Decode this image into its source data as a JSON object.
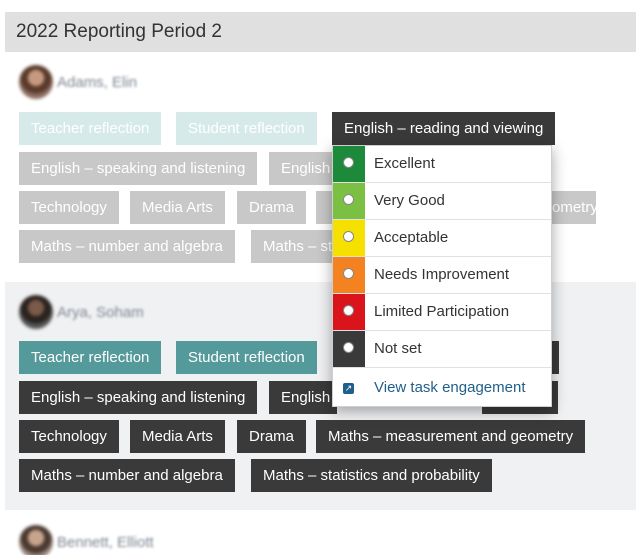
{
  "header": {
    "title": "2022 Reporting Period 2"
  },
  "students": [
    {
      "name": "Adams, Elin"
    },
    {
      "name": "Arya, Soham"
    },
    {
      "name": "Bennett, Elliott"
    }
  ],
  "tags": {
    "teacher_reflection": "Teacher reflection",
    "student_reflection": "Student reflection",
    "english_reading": "English – reading and viewing",
    "english_speaking": "English – speaking and listening",
    "english_partial": "English",
    "technology": "Technology",
    "media_arts": "Media Arts",
    "drama": "Drama",
    "maths_measurement": "Maths – measurement and geometry",
    "maths_measurement_tail": "ometry",
    "maths_number": "Maths – number and algebra",
    "maths_stats": "Maths – statistics and probability",
    "maths_stats_partial": "Maths – st"
  },
  "dropdown": {
    "options": [
      {
        "label": "Excellent",
        "color": "#1c8a3a"
      },
      {
        "label": "Very Good",
        "color": "#7bc043"
      },
      {
        "label": "Acceptable",
        "color": "#f5e000"
      },
      {
        "label": "Needs Improvement",
        "color": "#f58220"
      },
      {
        "label": "Limited Participation",
        "color": "#d9141b"
      },
      {
        "label": "Not set",
        "color": "#3a3a3a"
      }
    ],
    "link": {
      "label": "View task engagement",
      "icon": "external-link-icon"
    }
  }
}
